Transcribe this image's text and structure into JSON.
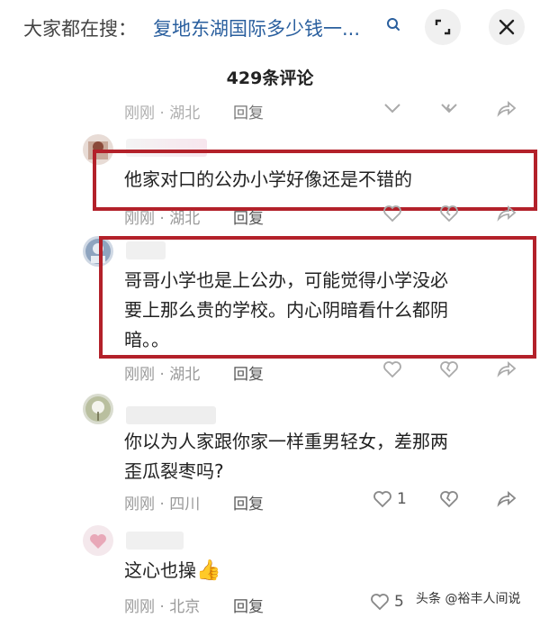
{
  "search": {
    "prefix": "大家都在搜：",
    "term": "复地东湖国际多少钱一...",
    "icon": "search-icon"
  },
  "header": {
    "title": "429条评论",
    "collapse_icon": "collapse-icon",
    "close_icon": "close-icon"
  },
  "comments": [
    {
      "meta": "刚刚 · 湖北",
      "reply": "回复",
      "text": ""
    },
    {
      "meta": "刚刚 · 湖北",
      "reply": "回复",
      "text": "他家对口的公办小学好像还是不错的"
    },
    {
      "meta": "刚刚 · 湖北",
      "reply": "回复",
      "line1": "哥哥小学也是上公办，可能觉得小学没必",
      "line2": "要上那么贵的学校。内心阴暗看什么都阴",
      "line3": "暗。。"
    },
    {
      "meta": "刚刚 · 四川",
      "reply": "回复",
      "line1": "你以为人家跟你家一样重男轻女，差那两",
      "line2": "歪瓜裂枣吗?",
      "likes": "1"
    },
    {
      "meta": "刚刚 · 北京",
      "reply": "回复",
      "text": "这心也操",
      "emoji": "👍",
      "likes": "5"
    }
  ],
  "footer": {
    "brand": "头条 @裕丰人间说"
  },
  "colors": {
    "highlight": "#b3212a",
    "link": "#2a5f9e",
    "meta": "#9a9a9a"
  }
}
